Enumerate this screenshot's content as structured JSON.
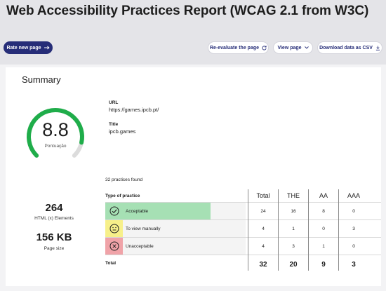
{
  "header": {
    "title": "Web Accessibility Practices Report (WCAG 2.1 from W3C)"
  },
  "toolbar": {
    "rate_new_page": "Rate new page",
    "reevaluate": "Re-evaluate the page",
    "view_page": "View page",
    "download_csv": "Download data as CSV"
  },
  "summary": {
    "title": "Summary",
    "score": "8.8",
    "score_fraction": 0.88,
    "score_label": "Pontuação",
    "url_label": "URL",
    "url_value": "https://games.ipcb.pt/",
    "title_label": "Title",
    "title_value": "ipcb.games",
    "html_elements_value": "264",
    "html_elements_label": "HTML (x) Elements",
    "page_size_value": "156 KB",
    "page_size_label": "Page size"
  },
  "practices": {
    "found_text": "32  practices found",
    "type_header": "Type of practice",
    "columns": [
      "Total",
      "THE",
      "AA",
      "AAA"
    ],
    "rows": [
      {
        "label": "Acceptable",
        "values": [
          "24",
          "16",
          "8",
          "0"
        ],
        "share": 0.75,
        "color": "#a6e0b4",
        "icon_color": "#a6e0b4",
        "icon": "check-circle-icon"
      },
      {
        "label": "To view manually",
        "values": [
          "4",
          "1",
          "0",
          "3"
        ],
        "share": 0.125,
        "color": "#f7f08a",
        "icon_color": "#f7f08a",
        "icon": "neutral-face-icon"
      },
      {
        "label": "Unacceptable",
        "values": [
          "4",
          "3",
          "1",
          "0"
        ],
        "share": 0.125,
        "color": "#f0a3a8",
        "icon_color": "#f0a3a8",
        "icon": "x-circle-icon"
      }
    ],
    "total_label": "Total",
    "totals": [
      "32",
      "20",
      "9",
      "3"
    ]
  },
  "colors": {
    "accent": "#262d78",
    "gauge": "#1fad4a",
    "gauge_track": "#dcdcdc"
  }
}
